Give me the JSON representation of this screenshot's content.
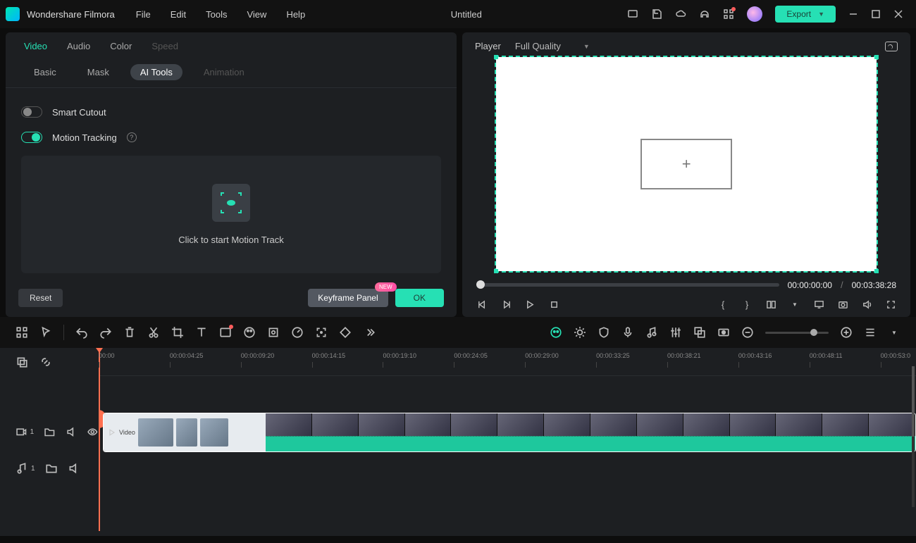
{
  "app": {
    "name": "Wondershare Filmora",
    "title": "Untitled"
  },
  "menu": [
    "File",
    "Edit",
    "Tools",
    "View",
    "Help"
  ],
  "export_label": "Export",
  "left_panel": {
    "tabs_primary": [
      {
        "label": "Video",
        "active": true
      },
      {
        "label": "Audio"
      },
      {
        "label": "Color"
      },
      {
        "label": "Speed",
        "disabled": true
      }
    ],
    "tabs_secondary": [
      {
        "label": "Basic"
      },
      {
        "label": "Mask"
      },
      {
        "label": "AI Tools",
        "active": true
      },
      {
        "label": "Animation",
        "disabled": true
      }
    ],
    "smart_cutout": {
      "label": "Smart Cutout",
      "on": false
    },
    "motion_tracking": {
      "label": "Motion Tracking",
      "on": true
    },
    "motion_track_cta": "Click to start Motion Track",
    "reset": "Reset",
    "keyframe": "Keyframe Panel",
    "keyframe_badge": "NEW",
    "ok": "OK"
  },
  "player": {
    "label": "Player",
    "quality": "Full Quality",
    "current_time": "00:00:00:00",
    "total_time": "00:03:38:28",
    "separator": "/"
  },
  "timeline": {
    "ticks": [
      "00:00",
      "00:00:04:25",
      "00:00:09:20",
      "00:00:14:15",
      "00:00:19:10",
      "00:00:24:05",
      "00:00:29:00",
      "00:00:33:25",
      "00:00:38:21",
      "00:00:43:16",
      "00:00:48:11",
      "00:00:53:0"
    ],
    "video_track_index": "1",
    "audio_track_index": "1"
  }
}
